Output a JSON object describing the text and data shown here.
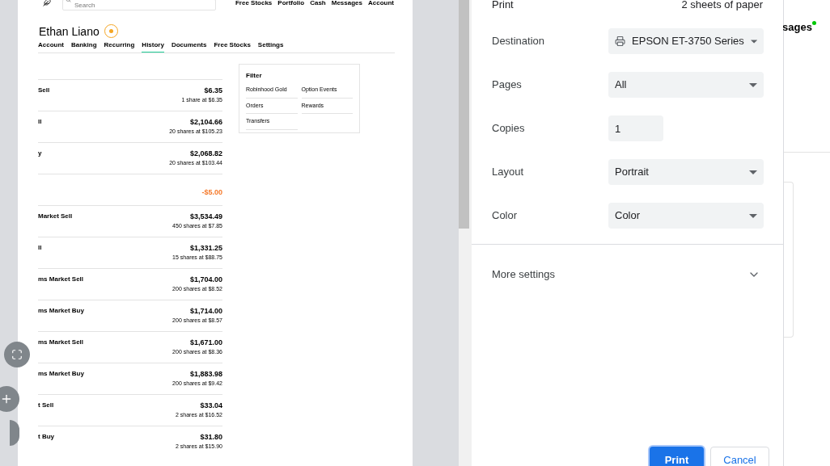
{
  "preview": {
    "search": {
      "placeholder": "Search"
    },
    "nav": [
      "Free Stocks",
      "Portfolio",
      "Cash",
      "Messages",
      "Account"
    ],
    "name": "Ethan Liano",
    "tabs": [
      {
        "label": "Account",
        "selected": false
      },
      {
        "label": "Banking",
        "selected": false
      },
      {
        "label": "Recurring",
        "selected": false
      },
      {
        "label": "History",
        "selected": true
      },
      {
        "label": "Documents",
        "selected": false
      },
      {
        "label": "Free Stocks",
        "selected": false
      },
      {
        "label": "Settings",
        "selected": false
      }
    ],
    "rows": [
      {
        "label": "Sell",
        "amount": "$6.35",
        "detail": "1 share at $6.35",
        "negative": false
      },
      {
        "label": "ll",
        "amount": "$2,104.66",
        "detail": "20 shares at $105.23",
        "negative": false
      },
      {
        "label": "y",
        "amount": "$2,068.82",
        "detail": "20 shares at $103.44",
        "negative": false
      },
      {
        "label": "",
        "amount": "-$5.00",
        "detail": "",
        "negative": true
      },
      {
        "label": "Market Sell",
        "amount": "$3,534.49",
        "detail": "450 shares at $7.85",
        "negative": false
      },
      {
        "label": "ll",
        "amount": "$1,331.25",
        "detail": "15 shares at $88.75",
        "negative": false
      },
      {
        "label": "ms Market Sell",
        "amount": "$1,704.00",
        "detail": "200 shares at $8.52",
        "negative": false
      },
      {
        "label": "ms Market Buy",
        "amount": "$1,714.00",
        "detail": "200 shares at $8.57",
        "negative": false
      },
      {
        "label": "ms Market Sell",
        "amount": "$1,671.00",
        "detail": "200 shares at $8.36",
        "negative": false
      },
      {
        "label": "ms Market Buy",
        "amount": "$1,883.98",
        "detail": "200 shares at $9.42",
        "negative": false
      },
      {
        "label": "t Sell",
        "amount": "$33.04",
        "detail": "2 shares at $16.52",
        "negative": false
      },
      {
        "label": "t Buy",
        "amount": "$31.80",
        "detail": "2 shares at $15.90",
        "negative": false
      }
    ],
    "filter": {
      "title": "Filter",
      "items": [
        "Robinhood Gold",
        "Option Events",
        "Orders",
        "Rewards",
        "Transfers"
      ]
    }
  },
  "dialog": {
    "title": "Print",
    "sheets": "2 sheets of paper",
    "settings": [
      {
        "label": "Destination",
        "kind": "select",
        "value": "EPSON ET-3750 Series",
        "printer": true
      },
      {
        "label": "Pages",
        "kind": "select",
        "value": "All",
        "printer": false
      },
      {
        "label": "Copies",
        "kind": "input",
        "value": "1",
        "printer": false
      },
      {
        "label": "Layout",
        "kind": "select",
        "value": "Portrait",
        "printer": false
      },
      {
        "label": "Color",
        "kind": "select",
        "value": "Color",
        "printer": false
      }
    ],
    "more": "More settings",
    "print": "Print",
    "cancel": "Cancel"
  },
  "background": {
    "messages": "sages",
    "unread": true
  }
}
